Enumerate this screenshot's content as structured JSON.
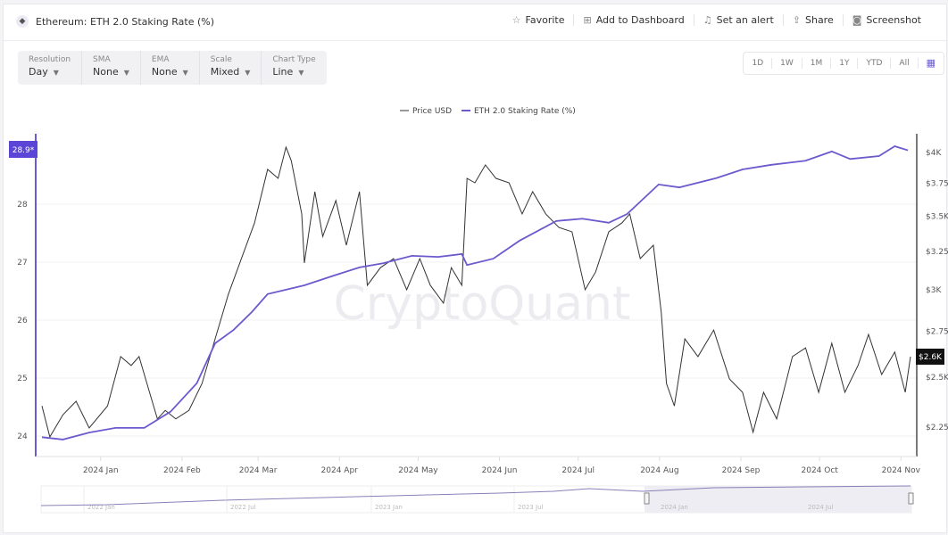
{
  "header": {
    "title": "Ethereum: ETH 2.0 Staking Rate (%)",
    "icon": "ethereum-icon",
    "actions": [
      {
        "label": "Favorite",
        "icon": "star-icon"
      },
      {
        "label": "Add to Dashboard",
        "icon": "dashboard-add-icon"
      },
      {
        "label": "Set an alert",
        "icon": "bell-icon"
      },
      {
        "label": "Share",
        "icon": "share-icon"
      },
      {
        "label": "Screenshot",
        "icon": "camera-icon"
      }
    ]
  },
  "options": [
    {
      "label": "Resolution",
      "value": "Day"
    },
    {
      "label": "SMA",
      "value": "None"
    },
    {
      "label": "EMA",
      "value": "None"
    },
    {
      "label": "Scale",
      "value": "Mixed"
    },
    {
      "label": "Chart Type",
      "value": "Line"
    }
  ],
  "ranges": [
    "1D",
    "1W",
    "1M",
    "1Y",
    "YTD",
    "All"
  ],
  "watermark": "CryptoQuant",
  "chart_data": {
    "type": "line",
    "title": "",
    "legend": [
      "Price USD",
      "ETH 2.0 Staking Rate (%)"
    ],
    "legend_placement": "top-center",
    "colors": {
      "price": "#333333",
      "staking": "#6a5acd",
      "badge_left": "#5b45d6",
      "badge_right": "#111111"
    },
    "x_ticks": [
      "2024 Jan",
      "2024 Feb",
      "2024 Mar",
      "2024 Apr",
      "2024 May",
      "2024 Jun",
      "2024 Jul",
      "2024 Aug",
      "2024 Sep",
      "2024 Oct",
      "2024 Nov"
    ],
    "xlim": [
      "2023-12-11",
      "2024-11-06"
    ],
    "left_axis": {
      "ticks": [
        "24",
        "25",
        "26",
        "27",
        "28"
      ],
      "ylim": [
        23.7,
        29.3
      ],
      "current": "28.9*"
    },
    "right_axis": {
      "scale": "log",
      "ticks": [
        "$2.25K",
        "$2.5K",
        "$2.75K",
        "$3K",
        "$3.25K",
        "$3.5K",
        "$3.75K",
        "$4K"
      ],
      "tick_values": [
        2250,
        2500,
        2750,
        3000,
        3250,
        3500,
        3750,
        4000
      ],
      "ylim": [
        2150,
        4350
      ],
      "current": "$2.6K"
    },
    "grid": true,
    "series": [
      {
        "name": "Price USD",
        "axis": "right",
        "x": [
          "2023-12-11",
          "2023-12-14",
          "2023-12-19",
          "2023-12-24",
          "2023-12-29",
          "2024-01-05",
          "2024-01-10",
          "2024-01-14",
          "2024-01-17",
          "2024-01-21",
          "2024-01-24",
          "2024-01-27",
          "2024-01-31",
          "2024-02-05",
          "2024-02-10",
          "2024-02-15",
          "2024-02-20",
          "2024-02-25",
          "2024-03-01",
          "2024-03-06",
          "2024-03-10",
          "2024-03-13",
          "2024-03-15",
          "2024-03-19",
          "2024-03-20",
          "2024-03-24",
          "2024-03-27",
          "2024-04-01",
          "2024-04-05",
          "2024-04-10",
          "2024-04-13",
          "2024-04-18",
          "2024-04-23",
          "2024-04-28",
          "2024-05-03",
          "2024-05-07",
          "2024-05-12",
          "2024-05-15",
          "2024-05-19",
          "2024-05-21",
          "2024-05-24",
          "2024-05-28",
          "2024-06-01",
          "2024-06-06",
          "2024-06-11",
          "2024-06-15",
          "2024-06-20",
          "2024-06-25",
          "2024-06-30",
          "2024-07-05",
          "2024-07-09",
          "2024-07-14",
          "2024-07-19",
          "2024-07-22",
          "2024-07-26",
          "2024-07-31",
          "2024-08-03",
          "2024-08-05",
          "2024-08-08",
          "2024-08-12",
          "2024-08-17",
          "2024-08-23",
          "2024-08-29",
          "2024-09-03",
          "2024-09-07",
          "2024-09-11",
          "2024-09-16",
          "2024-09-22",
          "2024-09-27",
          "2024-10-02",
          "2024-10-07",
          "2024-10-12",
          "2024-10-17",
          "2024-10-21",
          "2024-10-26",
          "2024-10-31",
          "2024-11-04",
          "2024-11-06"
        ],
        "values": [
          2353,
          2205,
          2310,
          2376,
          2247,
          2353,
          2609,
          2561,
          2609,
          2421,
          2290,
          2331,
          2290,
          2331,
          2466,
          2708,
          2971,
          3203,
          3451,
          3861,
          3789,
          4045,
          3933,
          3517,
          3174,
          3685,
          3355,
          3617,
          3294,
          3685,
          3029,
          3143,
          3203,
          3001,
          3203,
          3029,
          2918,
          3143,
          3029,
          3789,
          3754,
          3897,
          3789,
          3754,
          3517,
          3685,
          3517,
          3419,
          3388,
          3001,
          3115,
          3388,
          3451,
          3517,
          3203,
          3294,
          2864,
          2466,
          2353,
          2708,
          2609,
          2758,
          2490,
          2421,
          2227,
          2421,
          2290,
          2609,
          2657,
          2421,
          2683,
          2421,
          2561,
          2733,
          2513,
          2634,
          2421,
          2609
        ]
      },
      {
        "name": "ETH 2.0 Staking Rate (%)",
        "axis": "left",
        "x": [
          "2023-12-11",
          "2023-12-19",
          "2023-12-29",
          "2024-01-08",
          "2024-01-19",
          "2024-01-29",
          "2024-02-08",
          "2024-02-15",
          "2024-02-22",
          "2024-02-29",
          "2024-03-06",
          "2024-03-20",
          "2024-03-30",
          "2024-04-10",
          "2024-04-19",
          "2024-04-30",
          "2024-05-10",
          "2024-05-19",
          "2024-05-21",
          "2024-05-31",
          "2024-06-10",
          "2024-06-24",
          "2024-07-04",
          "2024-07-14",
          "2024-07-21",
          "2024-08-02",
          "2024-08-10",
          "2024-08-24",
          "2024-09-03",
          "2024-09-14",
          "2024-09-27",
          "2024-10-07",
          "2024-10-14",
          "2024-10-25",
          "2024-10-31",
          "2024-11-05"
        ],
        "values": [
          23.98,
          23.94,
          24.06,
          24.14,
          24.14,
          24.42,
          24.91,
          25.6,
          25.83,
          26.14,
          26.45,
          26.6,
          26.75,
          26.91,
          26.98,
          27.11,
          27.09,
          27.14,
          26.95,
          27.06,
          27.37,
          27.71,
          27.75,
          27.68,
          27.83,
          28.34,
          28.29,
          28.45,
          28.6,
          28.68,
          28.75,
          28.91,
          28.78,
          28.83,
          29.0,
          28.93
        ]
      }
    ],
    "navigator": {
      "labels": [
        "2022 Jan",
        "2022 Jul",
        "2023 Jan",
        "2023 Jul",
        "2024 Jan",
        "2024 Jul"
      ]
    }
  }
}
